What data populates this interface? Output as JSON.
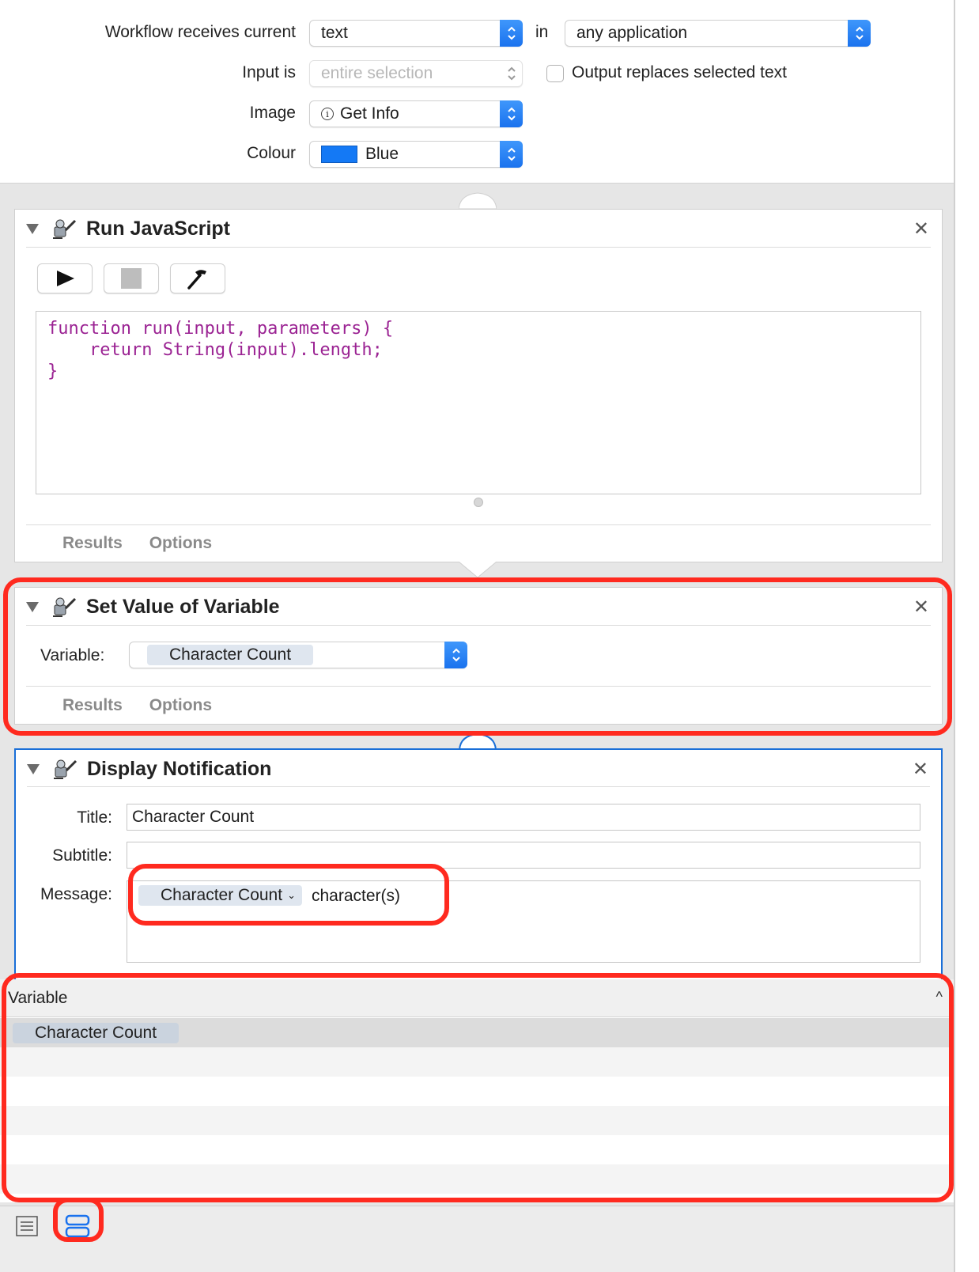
{
  "header": {
    "receives_label": "Workflow receives current",
    "receives_value": "text",
    "in_label": "in",
    "application_value": "any application",
    "input_is_label": "Input is",
    "input_is_value": "entire selection",
    "output_replaces_label": "Output replaces selected text",
    "output_replaces_checked": false,
    "image_label": "Image",
    "image_value": "Get Info",
    "image_icon": "info-circle-icon",
    "colour_label": "Colour",
    "colour_value": "Blue",
    "colour_swatch": "#1479f5"
  },
  "actions": [
    {
      "title": "Run JavaScript",
      "toolbar": [
        "run-icon",
        "stop-icon",
        "compile-hammer-icon"
      ],
      "code_lines": [
        "function run(input, parameters) {",
        "    return String(input).length;",
        "}"
      ],
      "tabs": [
        "Results",
        "Options"
      ]
    },
    {
      "title": "Set Value of Variable",
      "variable_label": "Variable:",
      "variable_value": "Character Count",
      "tabs": [
        "Results",
        "Options"
      ]
    },
    {
      "title": "Display Notification",
      "title_label": "Title:",
      "title_value": "Character Count",
      "subtitle_label": "Subtitle:",
      "subtitle_value": "",
      "message_label": "Message:",
      "message_token": "Character Count",
      "message_text": "character(s)"
    }
  ],
  "variables_table": {
    "column_header": "Variable",
    "rows": [
      "Character Count"
    ]
  },
  "bottom_bar": {
    "buttons": [
      "log-view-icon",
      "variables-view-icon"
    ]
  },
  "colors": {
    "accent": "#1a72ee",
    "highlight": "#ff2a1f",
    "code": "#9b2393"
  }
}
